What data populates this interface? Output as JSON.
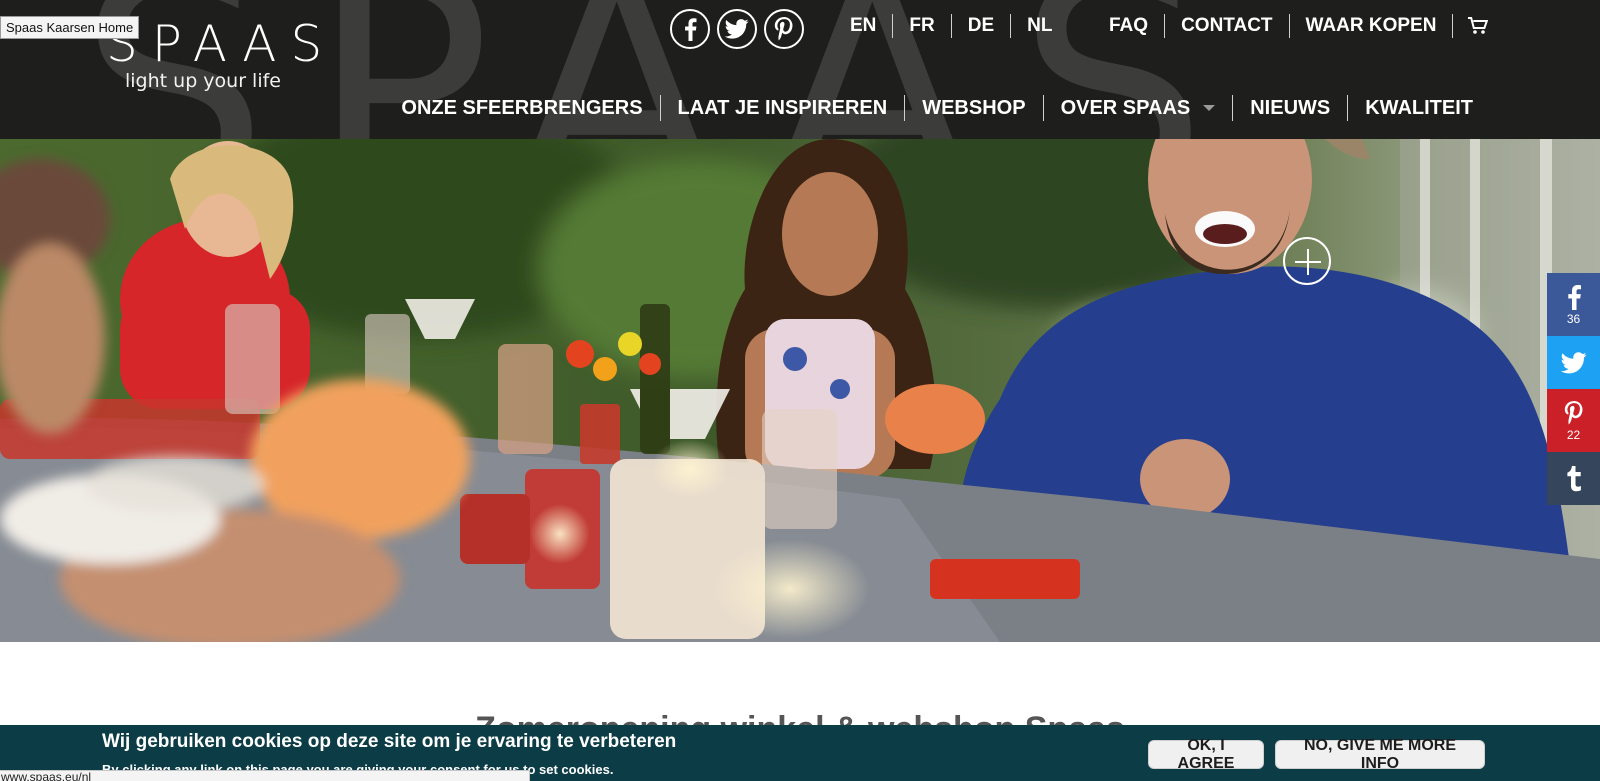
{
  "tooltip": "Spaas Kaarsen Home",
  "brand": {
    "name": "SPAAS",
    "tagline": "light up your life",
    "bg_word": "SPAAS"
  },
  "social_header": [
    {
      "icon": "facebook-icon"
    },
    {
      "icon": "twitter-icon"
    },
    {
      "icon": "pinterest-icon"
    }
  ],
  "languages": [
    "EN",
    "FR",
    "DE",
    "NL"
  ],
  "utility_nav": [
    "FAQ",
    "CONTACT",
    "WAAR KOPEN"
  ],
  "main_nav": [
    {
      "label": "ONZE SFEERBRENGERS"
    },
    {
      "label": "LAAT JE INSPIREREN"
    },
    {
      "label": "WEBSHOP"
    },
    {
      "label": "OVER SPAAS",
      "dropdown": true
    },
    {
      "label": "NIEUWS"
    },
    {
      "label": "KWALITEIT"
    }
  ],
  "share": {
    "facebook": {
      "count": "36"
    },
    "twitter": {
      "count": ""
    },
    "pinterest": {
      "count": "22"
    },
    "tumblr": {
      "count": ""
    }
  },
  "content": {
    "title": "Zomeropening winkel & webshop Spaas"
  },
  "cookie": {
    "title": "Wij gebruiken cookies op deze site om je ervaring te verbeteren",
    "subtitle": "By clicking any link on this page you are giving your consent for us to set cookies.",
    "agree": "OK, I AGREE",
    "more": "NO, GIVE ME MORE INFO"
  },
  "status_url": "www.spaas.eu/nl",
  "colors": {
    "header_bg": "#1e1e1c",
    "cookie_bg": "#0c3d47",
    "facebook": "#3b5998",
    "twitter": "#1da1f2",
    "pinterest": "#cb2027",
    "tumblr": "#35465c"
  }
}
